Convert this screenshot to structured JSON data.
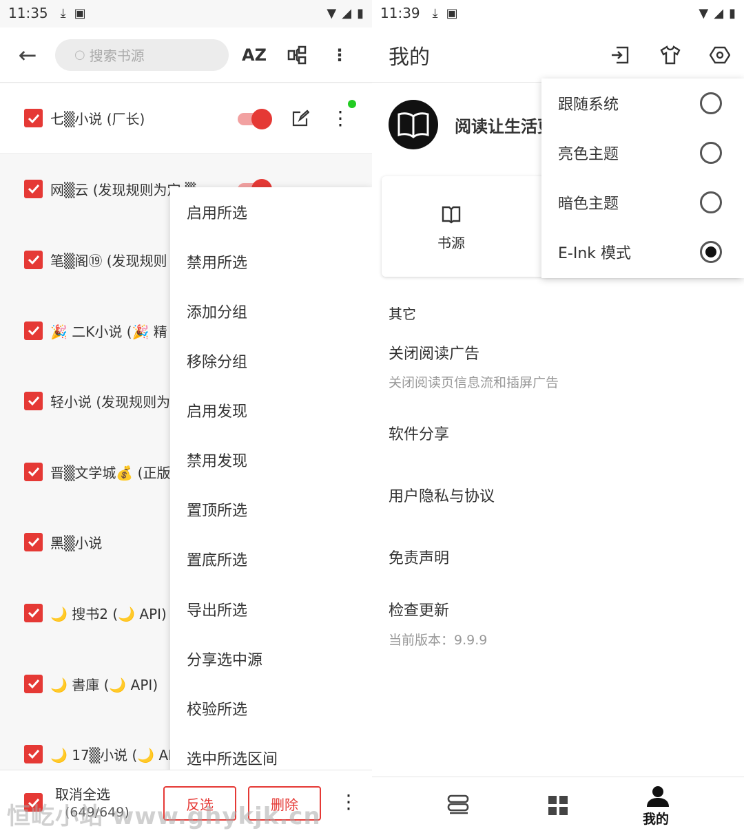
{
  "left": {
    "status": {
      "time": "11:35"
    },
    "search": {
      "placeholder": "搜索书源"
    },
    "toolbar": {
      "sort_label": "AZ"
    },
    "sources": [
      {
        "name": "七▒小说 (厂长)"
      },
      {
        "name": "网▒云 (发现规则为定 ▒"
      },
      {
        "name": "笔▒阁⑲ (发现规则"
      },
      {
        "name": "🎉 二K小说 (🎉 精"
      },
      {
        "name": "轻小说 (发现规则为"
      },
      {
        "name": "晋▒文学城💰 (正版"
      },
      {
        "name": "黑▒小说"
      },
      {
        "name": "🌙 搜书2 (🌙 API)"
      },
      {
        "name": "🌙 書庫 (🌙 API)"
      },
      {
        "name": "🌙 17▒小说 (🌙 AP"
      }
    ],
    "menu": [
      "启用所选",
      "禁用所选",
      "添加分组",
      "移除分组",
      "启用发现",
      "禁用发现",
      "置顶所选",
      "置底所选",
      "导出所选",
      "分享选中源",
      "校验所选",
      "选中所选区间"
    ],
    "select_bar": {
      "cancel_all": "取消全选",
      "count": "(649/649)",
      "invert": "反选",
      "delete": "删除"
    },
    "watermark": "恒屹小站 www.ghykjk.cn"
  },
  "right": {
    "status": {
      "time": "11:39"
    },
    "title": "我的",
    "slogan": "阅读让生活更",
    "theme_menu": [
      {
        "label": "跟随系统",
        "selected": false
      },
      {
        "label": "亮色主题",
        "selected": false
      },
      {
        "label": "暗色主题",
        "selected": false
      },
      {
        "label": "E-Ink 模式",
        "selected": true
      }
    ],
    "card_label": "书源",
    "section_other": "其它",
    "prefs": {
      "close_ads": {
        "title": "关闭阅读广告",
        "summary": "关闭阅读页信息流和插屏广告"
      },
      "share": {
        "title": "软件分享"
      },
      "privacy": {
        "title": "用户隐私与协议"
      },
      "disclaimer": {
        "title": "免责声明"
      },
      "update": {
        "title": "检查更新",
        "summary": "当前版本：9.9.9"
      }
    },
    "nav": {
      "mine": "我的"
    }
  },
  "colors": {
    "accent": "#e53935",
    "switch_track": "#f2a1a1",
    "online_dot": "#22cc22"
  }
}
